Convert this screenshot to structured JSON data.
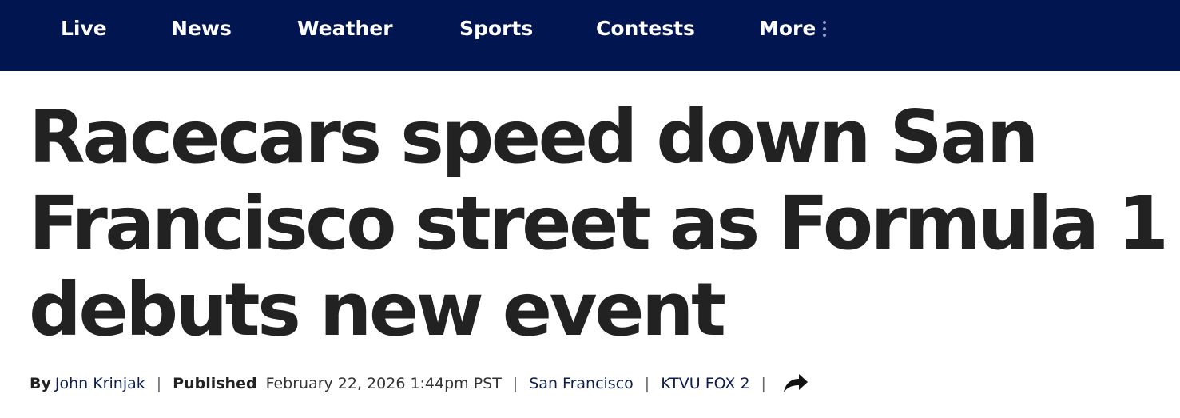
{
  "nav": {
    "items": [
      {
        "label": "Live"
      },
      {
        "label": "News"
      },
      {
        "label": "Weather"
      },
      {
        "label": "Sports"
      },
      {
        "label": "Contests"
      },
      {
        "label": "More"
      }
    ],
    "more_icon": "vertical-dots-icon",
    "background": "#011650"
  },
  "article": {
    "headline": "Racecars speed down San Francisco street as Formula 1 debuts new event",
    "byline": {
      "by_label": "By",
      "author": "John Krinjak",
      "published_label": "Published",
      "published_date": "February 22, 2026 1:44pm PST",
      "location": "San Francisco",
      "source": "KTVU FOX 2",
      "separator": "|",
      "share_icon": "share-arrow-icon"
    }
  }
}
